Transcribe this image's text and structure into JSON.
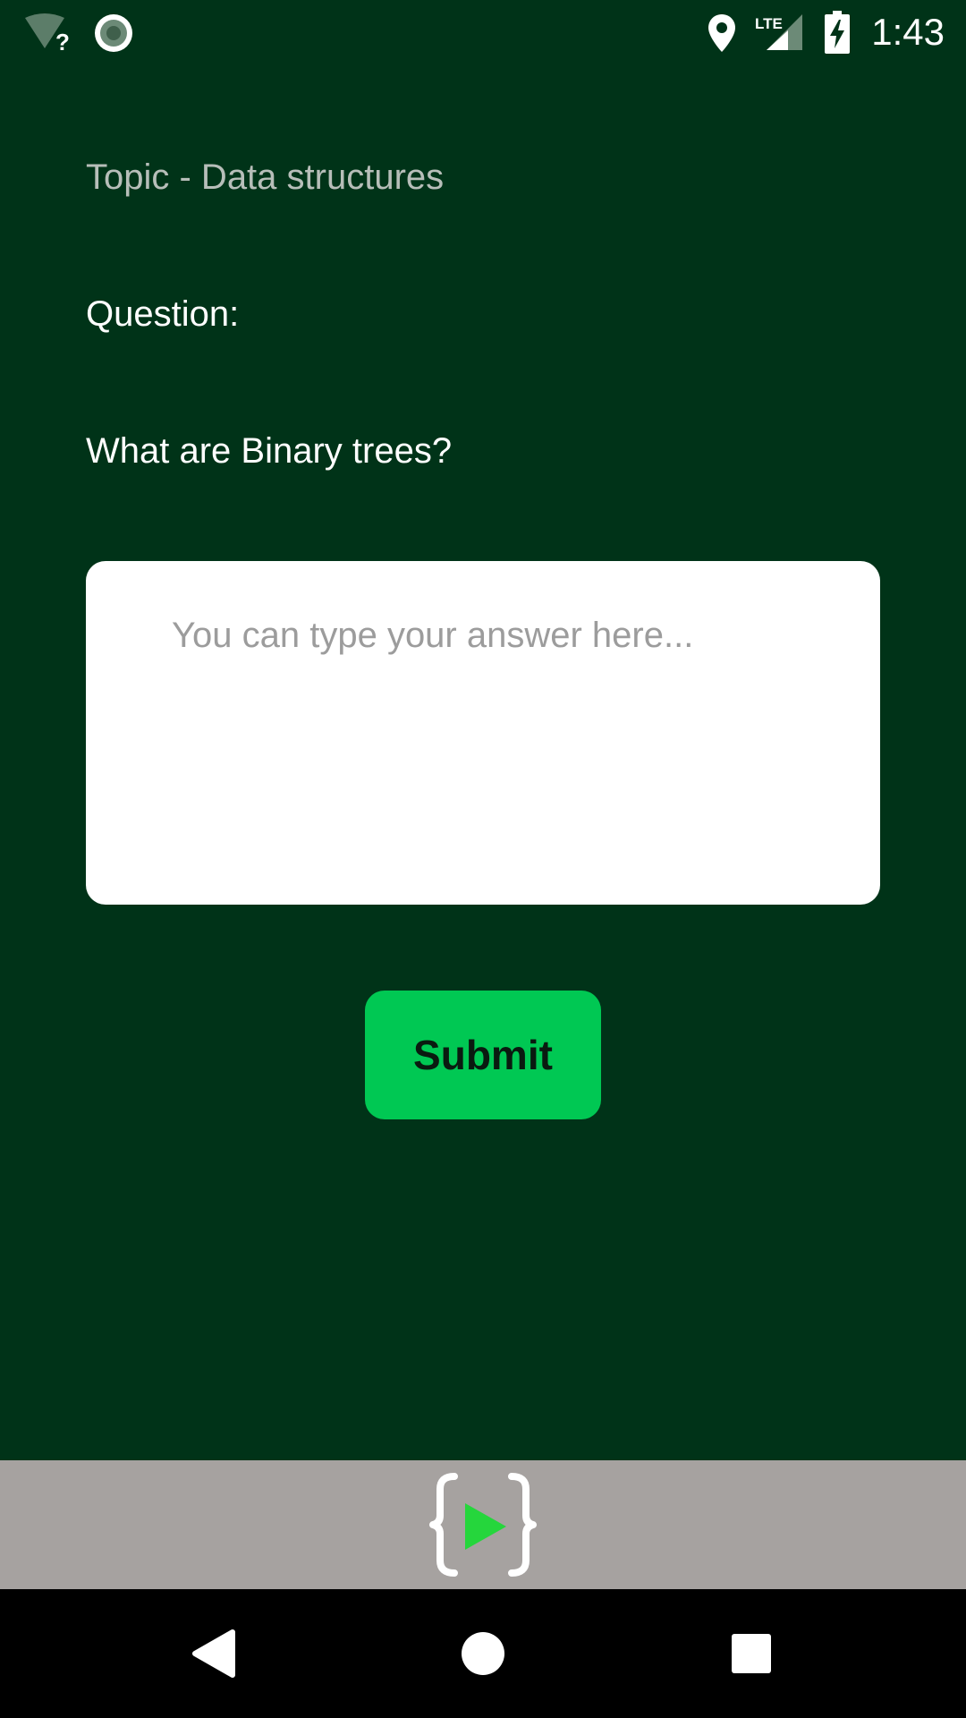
{
  "status_bar": {
    "time": "1:43",
    "icons": [
      "wifi-unknown-icon",
      "sync-circle-icon",
      "location-pin-icon",
      "lte-signal-icon",
      "battery-charging-icon"
    ],
    "network_label": "LTE"
  },
  "screen": {
    "topic": "Topic - Data structures",
    "question_label": "Question:",
    "question_text": "What are Binary trees?",
    "answer_placeholder": "You can type your answer here...",
    "answer_value": "",
    "submit_label": "Submit"
  },
  "footer": {
    "logo_icon": "code-play-logo-icon"
  },
  "nav_bar": {
    "buttons": [
      "back-icon",
      "home-icon",
      "recents-icon"
    ]
  },
  "colors": {
    "background": "#003318",
    "topic_text": "#b7beb9",
    "text": "#ffffff",
    "submit_button": "#00c853",
    "footer": "#a6a2a0",
    "nav_bar": "#000000"
  }
}
